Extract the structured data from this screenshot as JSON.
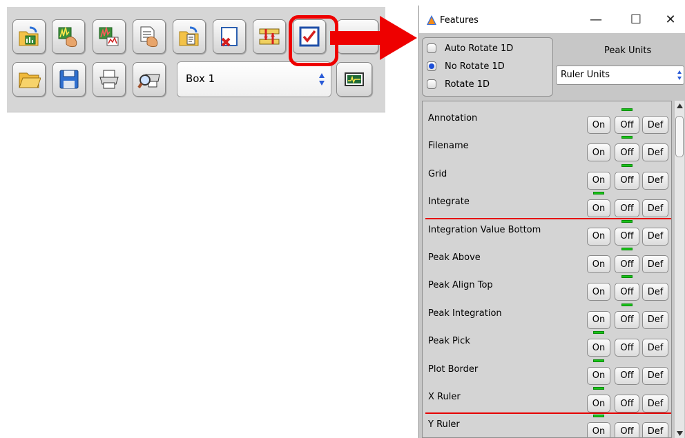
{
  "toolbar": {
    "row1_icons": [
      "open-spectrum-icon",
      "peak-pick-icon",
      "integrate-icon",
      "report-icon",
      "open-document-icon",
      "clear-icon",
      "ruler-icon",
      "features-checkbox-icon",
      "blank-icon"
    ],
    "row2_icons": [
      "open-folder-icon",
      "save-icon",
      "print-icon",
      "print-preview-icon"
    ],
    "box_select_value": "Box 1",
    "view_button_icon": "spectrum-view-icon"
  },
  "window": {
    "title": "Features",
    "minimize_glyph": "—",
    "maximize_glyph": "☐",
    "close_glyph": "✕"
  },
  "rotate": {
    "options": [
      {
        "label": "Auto Rotate 1D",
        "selected": false
      },
      {
        "label": "No Rotate 1D",
        "selected": true
      },
      {
        "label": "Rotate 1D",
        "selected": false
      }
    ]
  },
  "peak_units": {
    "title": "Peak Units",
    "value": "Ruler Units"
  },
  "buttons": {
    "on": "On",
    "off": "Off",
    "def": "Def"
  },
  "features": [
    {
      "label": "Annotation",
      "indicator": "off"
    },
    {
      "label": "Filename",
      "indicator": "off"
    },
    {
      "label": "Grid",
      "indicator": "off"
    },
    {
      "label": "Integrate",
      "indicator": "on"
    },
    {
      "label": "Integration Value Bottom",
      "indicator": "off"
    },
    {
      "label": "Peak Above",
      "indicator": "off"
    },
    {
      "label": "Peak Align Top",
      "indicator": "off"
    },
    {
      "label": "Peak Integration",
      "indicator": "off"
    },
    {
      "label": "Peak Pick",
      "indicator": "on"
    },
    {
      "label": "Plot Border",
      "indicator": "on"
    },
    {
      "label": "X Ruler",
      "indicator": "on"
    },
    {
      "label": "Y Ruler",
      "indicator": "on"
    }
  ],
  "colors": {
    "highlight": "#ee0000",
    "indicator": "#19c219",
    "radio_selected": "#1d4fd8"
  }
}
